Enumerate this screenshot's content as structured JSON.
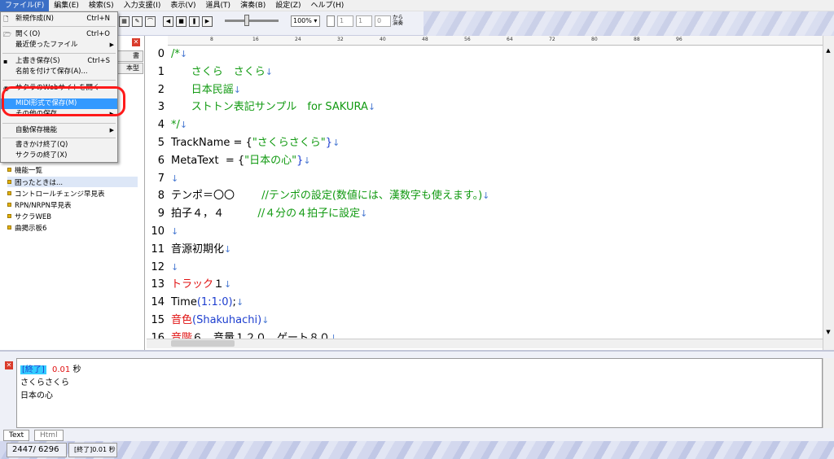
{
  "menubar": [
    "ファイル(F)",
    "編集(E)",
    "検索(S)",
    "入力支援(I)",
    "表示(V)",
    "道具(T)",
    "演奏(B)",
    "設定(Z)",
    "ヘルプ(H)"
  ],
  "file_menu": {
    "new": {
      "label": "新規作成(N)",
      "shortcut": "Ctrl+N"
    },
    "open": {
      "label": "開く(O)",
      "shortcut": "Ctrl+O"
    },
    "recent": {
      "label": "最近使ったファイル"
    },
    "save": {
      "label": "上書き保存(S)",
      "shortcut": "Ctrl+S"
    },
    "save_as": {
      "label": "名前を付けて保存(A)..."
    },
    "open_web": {
      "label": "サクラのWebサイトを開く"
    },
    "save_midi": {
      "label": "MIDI形式で保存(M)"
    },
    "other_save": {
      "label": "その他の保存..."
    },
    "autosave": {
      "label": "自動保存機能"
    },
    "close_edit": {
      "label": "書きかけ終了(Q)"
    },
    "quit": {
      "label": "サクラの終了(X)"
    }
  },
  "toolbar": {
    "zoom": "100%",
    "field1": "1",
    "field2": "1",
    "field3": "0",
    "from_play": "から演奏"
  },
  "left_tabs": [
    "書",
    "本型"
  ],
  "tree_items": [
    "機能一覧",
    "困ったときは...",
    "コントロールチェンジ早見表",
    "RPN/NRPN早見表",
    "サクラWEB",
    "曲掲示板6"
  ],
  "ruler_labels": [
    "8",
    "16",
    "24",
    "32",
    "40",
    "48",
    "56",
    "64",
    "72",
    "80",
    "88",
    "96"
  ],
  "code_lines": [
    {
      "n": "0",
      "parts": [
        {
          "t": "/*",
          "c": "g"
        }
      ]
    },
    {
      "n": "1",
      "parts": [
        {
          "t": "      さくら　さくら",
          "c": "g"
        }
      ]
    },
    {
      "n": "2",
      "parts": [
        {
          "t": "      日本民謡",
          "c": "g"
        }
      ]
    },
    {
      "n": "3",
      "parts": [
        {
          "t": "      ストトン表記サンプル　for SAKURA",
          "c": "g"
        }
      ]
    },
    {
      "n": "4",
      "parts": [
        {
          "t": "*/",
          "c": "g"
        }
      ]
    },
    {
      "n": "5",
      "parts": [
        {
          "t": "TrackName = {",
          "c": ""
        },
        {
          "t": "\"さくらさくら\"",
          "c": "g"
        },
        {
          "t": "}",
          "c": "b"
        }
      ]
    },
    {
      "n": "6",
      "parts": [
        {
          "t": "MetaText  = {",
          "c": ""
        },
        {
          "t": "\"日本の心\"",
          "c": "g"
        },
        {
          "t": "}",
          "c": "b"
        }
      ]
    },
    {
      "n": "7",
      "parts": []
    },
    {
      "n": "8",
      "parts": [
        {
          "t": "テンポ＝〇〇        ",
          "c": ""
        },
        {
          "t": "//テンポの設定(数値には、漢数字も使えます。)",
          "c": "g"
        }
      ]
    },
    {
      "n": "9",
      "parts": [
        {
          "t": "拍子４，４          ",
          "c": ""
        },
        {
          "t": "//４分の４拍子に設定",
          "c": "g"
        }
      ]
    },
    {
      "n": "10",
      "parts": []
    },
    {
      "n": "11",
      "parts": [
        {
          "t": "音源初期化",
          "c": ""
        }
      ]
    },
    {
      "n": "12",
      "parts": []
    },
    {
      "n": "13",
      "parts": [
        {
          "t": "トラック",
          "c": "r"
        },
        {
          "t": "１",
          "c": ""
        }
      ]
    },
    {
      "n": "14",
      "parts": [
        {
          "t": "Time",
          "c": ""
        },
        {
          "t": "(1:1:0)",
          "c": "b"
        },
        {
          "t": ";",
          "c": ""
        }
      ]
    },
    {
      "n": "15",
      "parts": [
        {
          "t": "音色",
          "c": "r"
        },
        {
          "t": "(Shakuhachi)",
          "c": "b"
        }
      ]
    },
    {
      "n": "16",
      "parts": [
        {
          "t": "音階",
          "c": "r"
        },
        {
          "t": "６　音量１２０　ゲート８０",
          "c": ""
        }
      ]
    }
  ],
  "output": {
    "tag": "[終了]",
    "time": "0.01",
    "unit": "秒",
    "line2": "さくらさくら",
    "line3": "日本の心"
  },
  "tabs": [
    "Text",
    "Html"
  ],
  "status": {
    "pos": "2447/ 6296",
    "msg": "[終了]0.01 秒"
  }
}
